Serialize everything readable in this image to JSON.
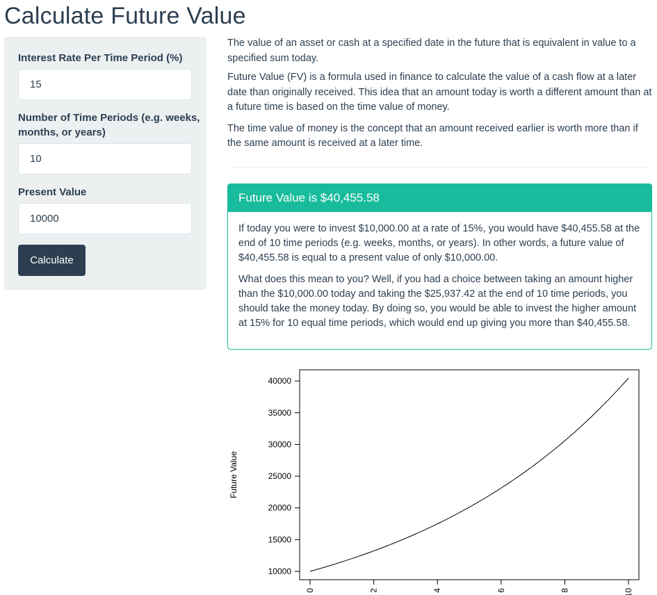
{
  "page": {
    "title": "Calculate Future Value"
  },
  "form": {
    "rate_label": "Interest Rate Per Time Period (%)",
    "rate_value": "15",
    "periods_label_line1": "Number of Time Periods (e.g. weeks,",
    "periods_label_line2": "months, or years)",
    "periods_value": "10",
    "pv_label": "Present Value",
    "pv_value": "10000",
    "calculate_label": "Calculate"
  },
  "description": {
    "p1": "The value of an asset or cash at a specified date in the future that is equivalent in value to a specified sum today.",
    "p2": "Future Value (FV) is a formula used in finance to calculate the value of a cash flow at a later date than originally received. This idea that an amount today is worth a different amount than at a future time is based on the time value of money.",
    "p3": "The time value of money is the concept that an amount received earlier is worth more than if the same amount is received at a later time."
  },
  "result": {
    "header": "Future Value is $40,455.58",
    "p1": "If today you were to invest $10,000.00 at a rate of 15%, you would have $40,455.58 at the end of 10 time periods (e.g. weeks, months, or years). In other words, a future value of $40,455.58 is equal to a present value of only $10,000.00.",
    "p2": "What does this mean to you? Well, if you had a choice between taking an amount higher than the $10,000.00 today and taking the $25,937.42 at the end of 10 time periods, you should take the money today. By doing so, you would be able to invest the higher amount at 15% for 10 equal time periods, which would end up giving you more than $40,455.58."
  },
  "chart_data": {
    "type": "line",
    "ylabel": "Future Value",
    "x_ticks": [
      "0",
      "2",
      "4",
      "6",
      "8",
      "10"
    ],
    "y_ticks": [
      "10000",
      "15000",
      "20000",
      "25000",
      "30000",
      "35000",
      "40000"
    ],
    "xlim": [
      0,
      10
    ],
    "ylim": [
      10000,
      40455.58
    ],
    "x": [
      0,
      1,
      2,
      3,
      4,
      5,
      6,
      7,
      8,
      9,
      10
    ],
    "values": [
      10000,
      11500,
      13225,
      15208.75,
      17490.06,
      20113.57,
      23130.61,
      26600.2,
      30590.23,
      35178.76,
      40455.58
    ],
    "line_color": "#000000"
  }
}
